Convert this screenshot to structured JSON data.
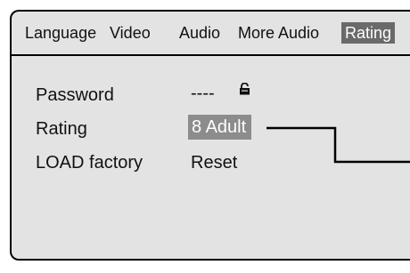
{
  "tabs": [
    {
      "label": "Language"
    },
    {
      "label": "Video"
    },
    {
      "label": "Audio"
    },
    {
      "label": "More Audio"
    },
    {
      "label": "Rating",
      "active": true
    }
  ],
  "rows": {
    "password": {
      "label": "Password",
      "value": "----"
    },
    "rating": {
      "label": "Rating",
      "value": "8 Adult"
    },
    "load_factory": {
      "label": "LOAD factory",
      "value": "Reset"
    }
  },
  "icons": {
    "password_lock": "lock-icon"
  },
  "colors": {
    "panel_bg": "#e3e3e3",
    "active_tab_bg": "#6a6a6a",
    "selected_value_bg": "#8c8c8c"
  }
}
